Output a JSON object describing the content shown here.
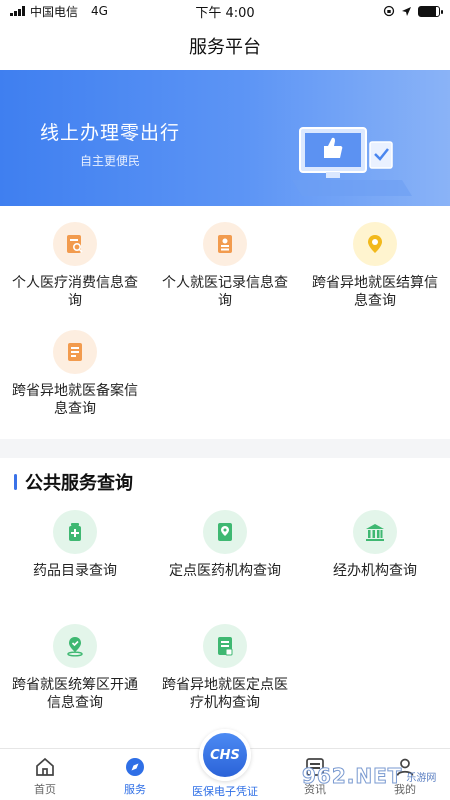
{
  "status_bar": {
    "carrier": "中国电信",
    "network": "4G",
    "time": "下午 4:00",
    "battery_percent": 85
  },
  "header": {
    "title": "服务平台"
  },
  "banner": {
    "title": "线上办理零出行",
    "subtitle": "自主更便民"
  },
  "quick_services": [
    {
      "label": "个人医疗消费信息查询",
      "icon": "receipt-search-icon"
    },
    {
      "label": "个人就医记录信息查询",
      "icon": "medical-record-icon"
    },
    {
      "label": "跨省异地就医结算信息查询",
      "icon": "location-pin-icon"
    },
    {
      "label": "跨省异地就医备案信息查询",
      "icon": "filing-document-icon"
    }
  ],
  "public_services": {
    "title": "公共服务查询",
    "items": [
      {
        "label": "药品目录查询",
        "icon": "medicine-bottle-icon"
      },
      {
        "label": "定点医药机构查询",
        "icon": "hospital-location-icon"
      },
      {
        "label": "经办机构查询",
        "icon": "institution-building-icon"
      },
      {
        "label": "跨省就医统筹区开通信息查询",
        "icon": "map-check-icon"
      },
      {
        "label": "跨省异地就医定点医疗机构查询",
        "icon": "clinic-document-icon"
      }
    ]
  },
  "tab_bar": {
    "tabs": [
      {
        "label": "首页",
        "icon": "home-icon"
      },
      {
        "label": "服务",
        "icon": "compass-icon"
      },
      {
        "label": "医保电子凭证",
        "icon": "chs-icon"
      },
      {
        "label": "资讯",
        "icon": "news-icon"
      },
      {
        "label": "我的",
        "icon": "user-icon"
      }
    ],
    "active": "服务",
    "center_badge": "CHS"
  },
  "watermark": {
    "text": "962.NET",
    "sub": "乐游网"
  },
  "colors": {
    "accent": "#2f6fe6",
    "banner_start": "#3f7ff0",
    "banner_end": "#8ab3f7",
    "orange_icon": "#f29b4e",
    "yellow_icon": "#f2b91c",
    "green_icon": "#3fb872"
  }
}
